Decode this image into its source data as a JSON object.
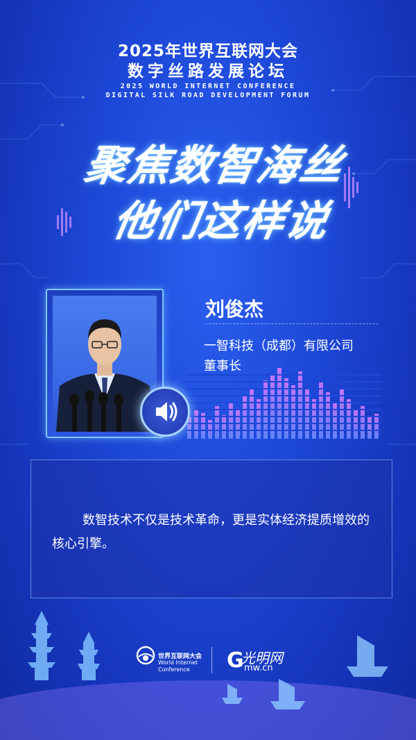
{
  "header": {
    "line1": "2025年世界互联网大会",
    "line2": "数字丝路发展论坛",
    "en_line1": "2025 WORLD INTERNET CONFERENCE",
    "en_line2": "DIGITAL SILK ROAD DEVELOPMENT FORUM"
  },
  "title": {
    "line1": "聚焦数智海丝",
    "line2": "他们这样说"
  },
  "speaker": {
    "name": "刘俊杰",
    "organization": "一智科技（成都）有限公司",
    "role": "董事长"
  },
  "quote": {
    "text": "数智技术不仅是技术革命，更是实体经济提质增效的核心引擎。"
  },
  "footer": {
    "wic_cn": "世界互联网大会",
    "wic_en1": "World Internet",
    "wic_en2": "Conference",
    "gmw_script": "光明网",
    "gmw_g": "G",
    "gmw_domain": "mw.cn"
  },
  "icons": {
    "speaker": "speaker-volume-icon",
    "wic_logo": "wic-logo-icon"
  },
  "colors": {
    "background": "#1d47d6",
    "accent_glow": "#7fc6ff",
    "equalizer_top": "#e27bff",
    "equalizer_bottom": "#6c8cff"
  }
}
